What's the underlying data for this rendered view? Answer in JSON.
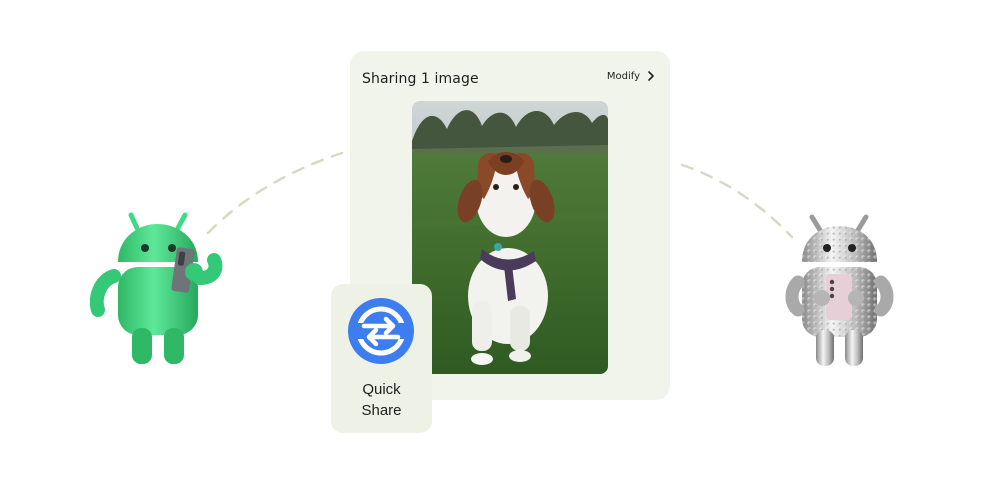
{
  "share_sheet": {
    "title": "Sharing 1 image",
    "modify_label": "Modify",
    "image_alt": "Photo of a brown and white dog sitting on grass"
  },
  "quick_share": {
    "label": "Quick\nShare",
    "icon": "quick-share-arrows-icon",
    "icon_color": "#3d7df0"
  },
  "colors": {
    "card_background": "#f1f4ea",
    "dashed_line": "#d9d8c6",
    "green_android": "#3ddc84"
  },
  "characters": {
    "left": "green-android-bot-holding-phone",
    "right": "silver-android-bot-holding-phone"
  }
}
